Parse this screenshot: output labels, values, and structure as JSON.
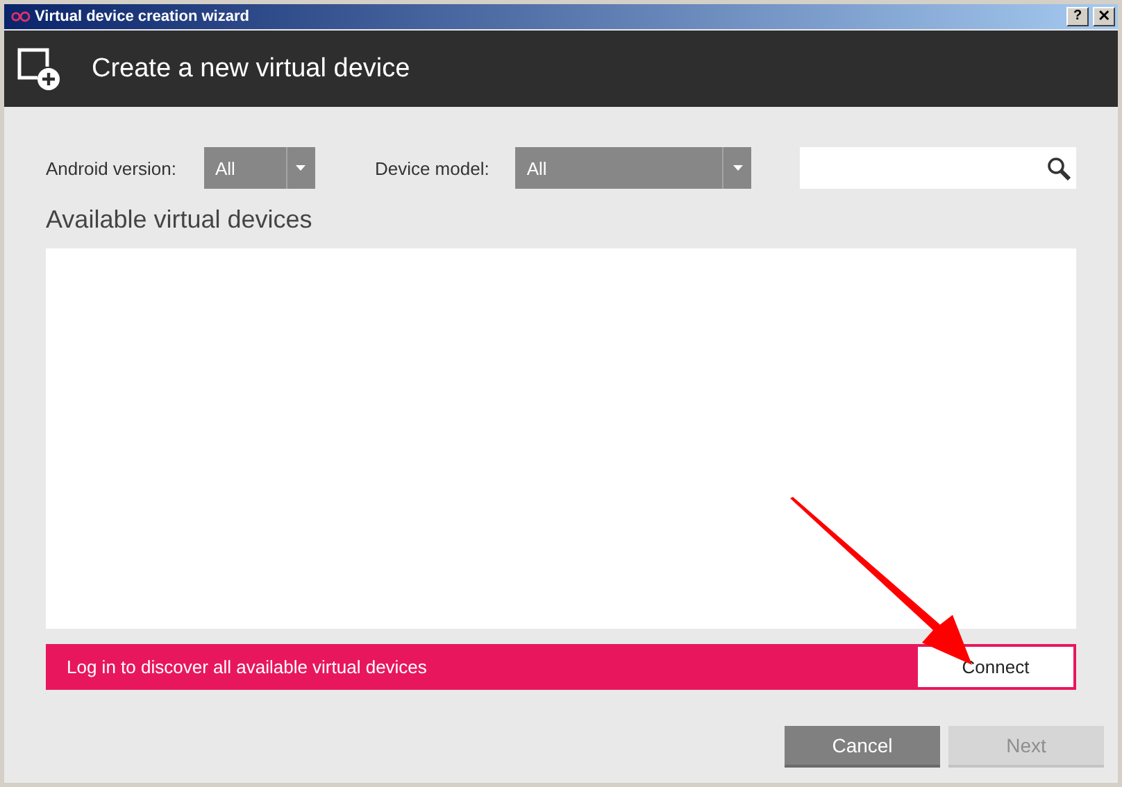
{
  "window": {
    "title": "Virtual device creation wizard",
    "controls": [
      {
        "kind": "help",
        "label": "?"
      },
      {
        "kind": "close",
        "label": "✕"
      }
    ]
  },
  "header": {
    "title": "Create a new virtual device"
  },
  "filters": [
    {
      "label": "Android version:",
      "value": "All",
      "kind": "short"
    },
    {
      "label": "Device model:",
      "value": "All",
      "kind": "long"
    }
  ],
  "section_title": "Available virtual devices",
  "banner": {
    "text": "Log in to discover all available virtual devices",
    "button": "Connect"
  },
  "buttons": [
    {
      "label": "Cancel",
      "disabled": false
    },
    {
      "label": "Next",
      "disabled": true
    }
  ]
}
